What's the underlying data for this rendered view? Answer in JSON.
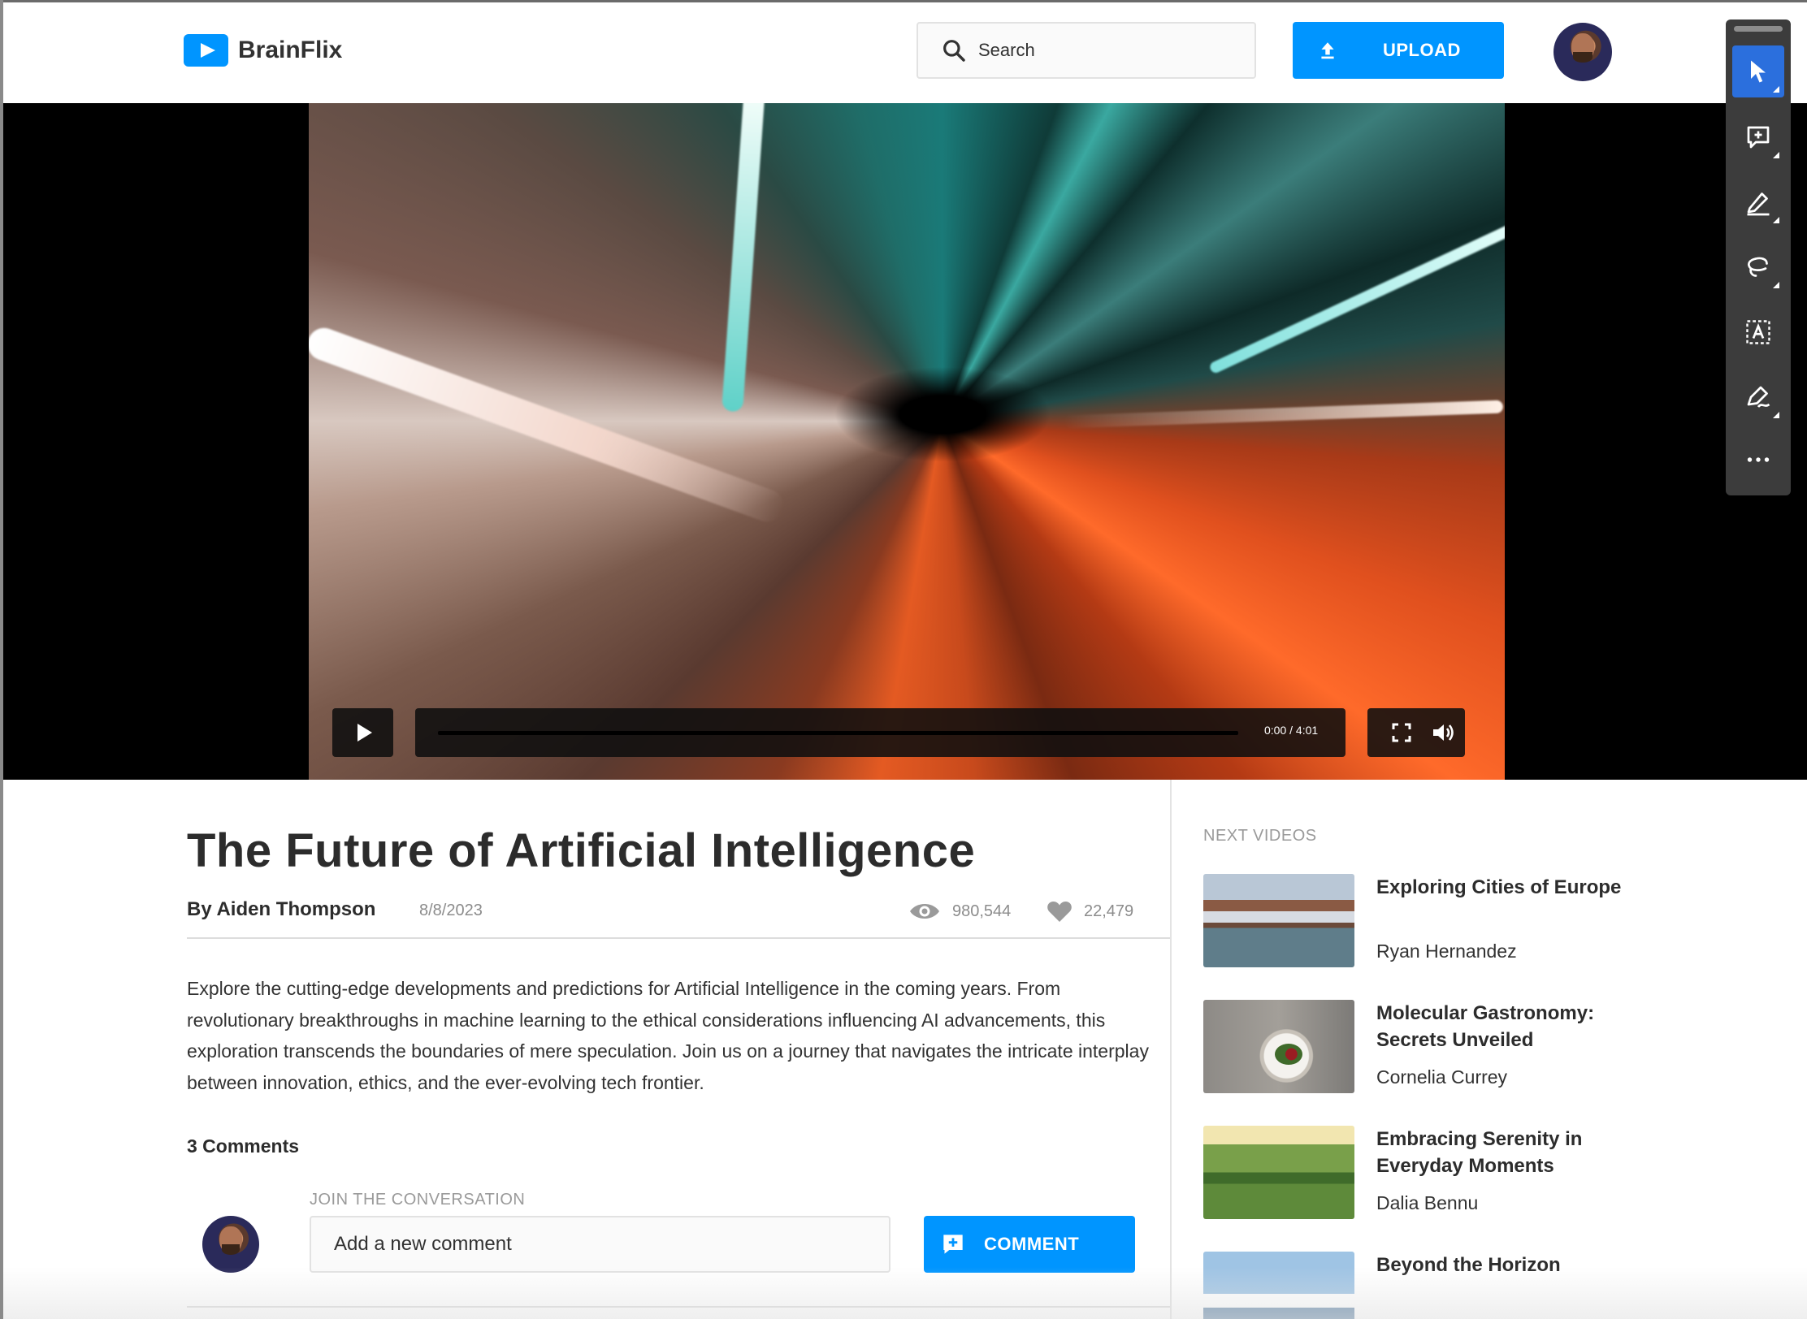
{
  "app": {
    "name": "BrainFlix"
  },
  "header": {
    "search_placeholder": "Search",
    "upload_label": "UPLOAD"
  },
  "player": {
    "time": "0:00 / 4:01",
    "progress": 0
  },
  "toolbar": {
    "tools": [
      "select-pointer-icon",
      "add-comment-icon",
      "draw-pen-icon",
      "lasso-icon",
      "text-select-icon",
      "sign-pen-icon",
      "more-icon"
    ]
  },
  "video": {
    "title": "The Future of Artificial Intelligence",
    "byline": "By Aiden Thompson",
    "date": "8/8/2023",
    "views": "980,544",
    "likes": "22,479",
    "description": "Explore the cutting-edge developments and predictions for Artificial Intelligence in the coming years. From revolutionary breakthroughs in machine learning to the ethical considerations influencing AI advancements, this exploration transcends the boundaries of mere speculation. Join us on a journey that navigates the intricate interplay between innovation, ethics, and the ever-evolving tech frontier."
  },
  "comments": {
    "count_label": "3 Comments",
    "join_label": "JOIN THE CONVERSATION",
    "input_placeholder": "Add a new comment",
    "button_label": "COMMENT"
  },
  "next_videos": {
    "label": "NEXT VIDEOS",
    "items": [
      {
        "title": "Exploring Cities of Europe",
        "author": "Ryan Hernandez"
      },
      {
        "title": "Molecular Gastronomy: Secrets Unveiled",
        "author": "Cornelia Currey"
      },
      {
        "title": "Embracing Serenity in Everyday Moments",
        "author": "Dalia Bennu"
      },
      {
        "title": "Beyond the Horizon",
        "author": ""
      }
    ]
  },
  "colors": {
    "accent": "#0095FF",
    "toolbar_active": "#2B6FDD",
    "text": "#323232",
    "muted": "#9A9A9A"
  }
}
